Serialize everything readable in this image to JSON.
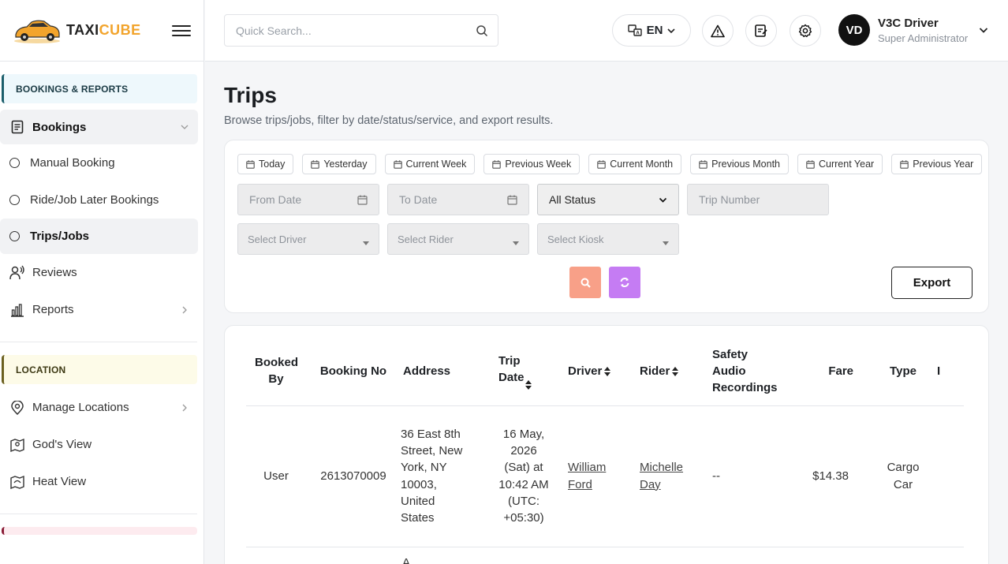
{
  "brand": {
    "part1": "TAXI",
    "part2": "CUBE"
  },
  "sidebar": {
    "sections": [
      {
        "title": "BOOKINGS & REPORTS"
      },
      {
        "title": "LOCATION"
      }
    ],
    "bookings_group": "Bookings",
    "bookings_items": [
      "Manual Booking",
      "Ride/Job Later Bookings",
      "Trips/Jobs"
    ],
    "reviews": "Reviews",
    "reports": "Reports",
    "location_items": [
      "Manage Locations",
      "God's View",
      "Heat View"
    ]
  },
  "topbar": {
    "search_placeholder": "Quick Search...",
    "language": "EN",
    "user": {
      "initials": "VD",
      "name": "V3C Driver",
      "role": "Super Administrator"
    }
  },
  "page": {
    "title": "Trips",
    "subtitle": "Browse trips/jobs, filter by date/status/service, and export results."
  },
  "filters": {
    "quick_ranges": [
      "Today",
      "Yesterday",
      "Current Week",
      "Previous Week",
      "Current Month",
      "Previous Month",
      "Current Year",
      "Previous Year"
    ],
    "from_date": "From Date",
    "to_date": "To Date",
    "status": "All Status",
    "trip_number": "Trip Number",
    "driver": "Select Driver",
    "rider": "Select Rider",
    "kiosk": "Select Kiosk",
    "export_label": "Export"
  },
  "table": {
    "headers": {
      "booked_by": "Booked By",
      "booking_no": "Booking No",
      "address": "Address",
      "trip_date": "Trip Date",
      "driver": "Driver",
      "rider": "Rider",
      "audio": "Safety Audio Recordings",
      "fare": "Fare",
      "type": "Type",
      "next": "I"
    },
    "rows": [
      {
        "booked_by": "User",
        "booking_no": "2613070009",
        "address": "36 East 8th Street, New York, NY 10003, United States",
        "trip_date": "16 May, 2026 (Sat) at 10:42 AM (UTC: +05:30)",
        "driver": "William Ford",
        "rider": "Michelle Day",
        "audio": "--",
        "fare": "$14.38",
        "type": "Cargo Car"
      }
    ],
    "next_row_peek": "A"
  }
}
